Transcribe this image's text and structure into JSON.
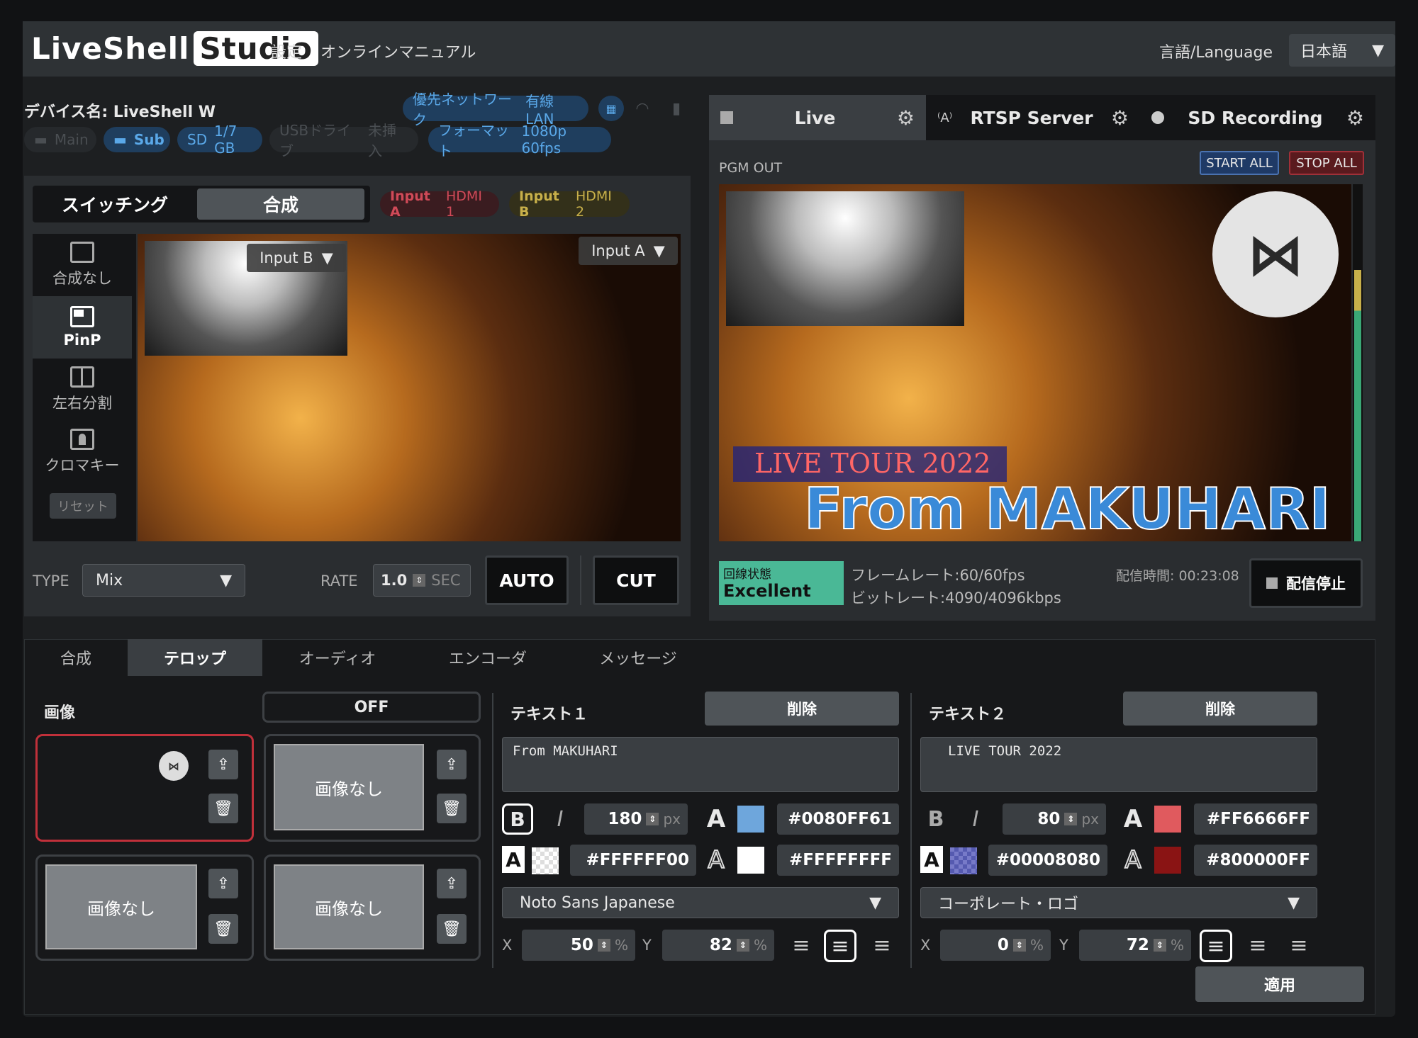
{
  "app": {
    "logo": "LiveShell",
    "logo_studio": "Studio",
    "menu_settings": "設定",
    "menu_manual": "オンラインマニュアル",
    "lang_label": "言語/Language",
    "lang_value": "日本語"
  },
  "device": {
    "name_label": "デバイス名: LiveShell W",
    "net_label": "優先ネットワーク",
    "net_value": "有線LAN",
    "main": "Main",
    "sub": "Sub",
    "sd_label": "SD",
    "sd_value": "1/7 GB",
    "usb_label": "USBドライブ",
    "usb_value": "未挿入",
    "format_label": "フォーマット",
    "format_value": "1080p 60fps"
  },
  "switcher": {
    "tab_switching": "スイッチング",
    "tab_compose": "合成",
    "input_a": "Input A",
    "input_a_port": "HDMI 1",
    "input_b": "Input B",
    "input_b_port": "HDMI 2",
    "modes": [
      {
        "label": "合成なし"
      },
      {
        "label": "PinP"
      },
      {
        "label": "左右分割"
      },
      {
        "label": "クロマキー"
      }
    ],
    "reset": "リセット",
    "overlay_b": "Input B",
    "overlay_a": "Input A",
    "type_label": "TYPE",
    "type_value": "Mix",
    "rate_label": "RATE",
    "rate_value": "1.0",
    "rate_unit": "SEC",
    "auto": "AUTO",
    "cut": "CUT"
  },
  "output": {
    "tab_live": "Live",
    "tab_rtsp": "RTSP Server",
    "tab_sd": "SD Recording",
    "pgm_label": "PGM OUT",
    "start_all": "START ALL",
    "stop_all": "STOP ALL",
    "title_small": "LIVE TOUR 2022",
    "title_big": "From MAKUHARI",
    "line_label": "回線状態",
    "line_value": "Excellent",
    "framerate": "フレームレート:60/60fps",
    "bitrate": "ビットレート:4090/4096kbps",
    "duration": "配信時間: 00:23:08",
    "stop_stream": "配信停止"
  },
  "bottom_tabs": [
    "合成",
    "テロップ",
    "オーディオ",
    "エンコーダ",
    "メッセージ"
  ],
  "telop": {
    "image_label": "画像",
    "off": "OFF",
    "noimage": "画像なし",
    "text1": {
      "title": "テキスト１",
      "delete": "削除",
      "content": "From MAKUHARI",
      "size": "180",
      "size_unit": "px",
      "color": "#0080FF61",
      "bg_color": "#FFFFFF00",
      "outline_color": "#FFFFFFFF",
      "font": "Noto Sans Japanese",
      "x_label": "X",
      "x": "50",
      "y_label": "Y",
      "y": "82",
      "pct": "%"
    },
    "text2": {
      "title": "テキスト２",
      "delete": "削除",
      "content": "LIVE TOUR 2022",
      "size": "80",
      "size_unit": "px",
      "color": "#FF6666FF",
      "bg_color": "#00008080",
      "outline_color": "#800000FF",
      "font": "コーポレート・ロゴ",
      "x_label": "X",
      "x": "0",
      "y_label": "Y",
      "y": "72",
      "pct": "%"
    },
    "apply": "適用"
  }
}
